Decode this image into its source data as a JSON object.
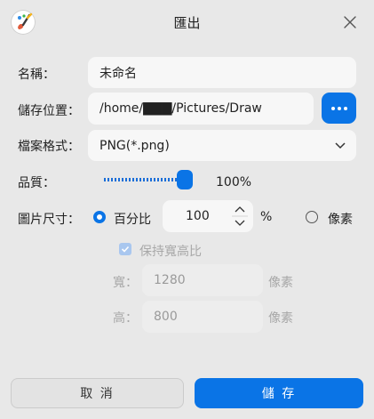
{
  "window": {
    "title": "匯出",
    "app_icon": "paintbrush-app-icon",
    "close_icon": "close-icon"
  },
  "form": {
    "name": {
      "label": "名稱：",
      "value": "未命名"
    },
    "save_location": {
      "label": "儲存位置：",
      "value": "/home/▇▇▇/Pictures/Draw",
      "browse_icon": "ellipsis-icon"
    },
    "file_format": {
      "label": "檔案格式：",
      "value": "PNG(*.png)"
    },
    "quality": {
      "label": "品質：",
      "percent": 100,
      "value_text": "100%"
    },
    "image_size": {
      "label": "圖片尺寸：",
      "mode_percent": {
        "label": "百分比",
        "selected": true
      },
      "percent_value": "100",
      "percent_unit": "%",
      "mode_pixels": {
        "label": "像素",
        "selected": false
      },
      "keep_ratio": {
        "label": "保持寬高比",
        "checked": true,
        "enabled": false
      },
      "width": {
        "label": "寬：",
        "value": "1280",
        "unit": "像素"
      },
      "height": {
        "label": "高：",
        "value": "800",
        "unit": "像素"
      }
    }
  },
  "buttons": {
    "cancel": "取 消",
    "save": "儲 存"
  },
  "colors": {
    "accent": "#0a74e6",
    "background": "#e8e8e8",
    "field": "#f7f7f7"
  }
}
